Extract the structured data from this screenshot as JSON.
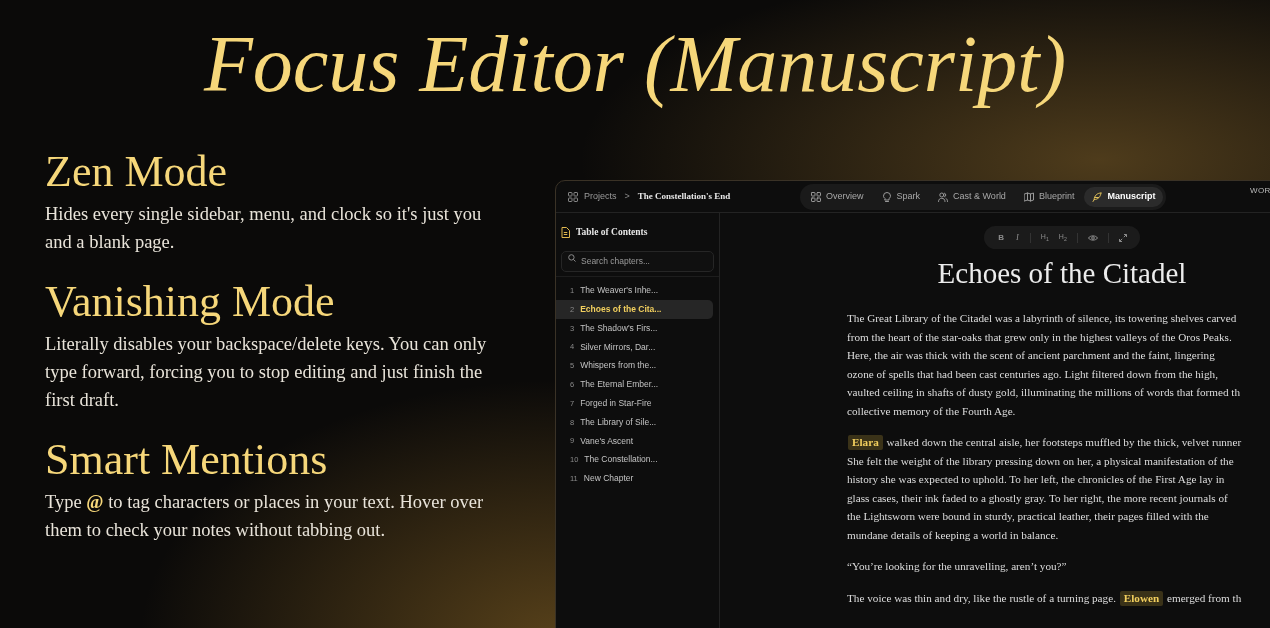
{
  "headline": "Focus Editor (Manuscript)",
  "features": [
    {
      "title": "Zen Mode",
      "description": [
        {
          "text": "Hides every single sidebar, menu, and clock so it's just you and a blank page.",
          "kind": "plain"
        }
      ]
    },
    {
      "title": "Vanishing Mode",
      "description": [
        {
          "text": "Literally disables your backspace/delete keys. You can only type forward, forcing you to stop editing and just finish the first draft.",
          "kind": "plain"
        }
      ]
    },
    {
      "title": "Smart Mentions",
      "description": [
        {
          "text": "Type ",
          "kind": "plain"
        },
        {
          "text": "@",
          "kind": "accent"
        },
        {
          "text": " to tag characters or places in your text. Hover over them to check your notes without tabbing out.",
          "kind": "plain"
        }
      ]
    }
  ],
  "app": {
    "breadcrumb": {
      "root": "Projects",
      "separator": ">",
      "current": "The Constellation's End"
    },
    "tabs": [
      {
        "label": "Overview",
        "selected": false
      },
      {
        "label": "Spark",
        "selected": false
      },
      {
        "label": "Cast & World",
        "selected": false
      },
      {
        "label": "Blueprint",
        "selected": false
      },
      {
        "label": "Manuscript",
        "selected": true
      }
    ],
    "top_right_label": "WOR",
    "sidebar": {
      "title": "Table of Contents",
      "search": {
        "placeholder": "Search chapters..."
      },
      "chapters": [
        {
          "number": "1",
          "title": "The Weaver's Inhe...",
          "selected": false
        },
        {
          "number": "2",
          "title": "Echoes of the Cita...",
          "selected": true
        },
        {
          "number": "3",
          "title": "The Shadow's Firs...",
          "selected": false
        },
        {
          "number": "4",
          "title": "Silver Mirrors, Dar...",
          "selected": false
        },
        {
          "number": "5",
          "title": "Whispers from the...",
          "selected": false
        },
        {
          "number": "6",
          "title": "The Eternal Ember...",
          "selected": false
        },
        {
          "number": "7",
          "title": "Forged in Star-Fire",
          "selected": false
        },
        {
          "number": "8",
          "title": "The Library of Sile...",
          "selected": false
        },
        {
          "number": "9",
          "title": "Vane's Ascent",
          "selected": false
        },
        {
          "number": "10",
          "title": "The Constellation...",
          "selected": false
        },
        {
          "number": "11",
          "title": "New Chapter",
          "selected": false
        }
      ]
    },
    "toolbar": {
      "buttons": [
        {
          "label": "B",
          "kind": "bold"
        },
        {
          "label": "I",
          "kind": "italic"
        },
        {
          "label": "H$_{1}$",
          "kind": "heading"
        },
        {
          "label": "H$_{2}$",
          "kind": "heading"
        },
        {
          "kind": "eye"
        },
        {
          "kind": "expand"
        }
      ]
    },
    "chapter_title": "Echoes of the Citadel",
    "paragraphs": [
      {
        "lines": [
          [
            {
              "text": "The Great Library of the Citadel was a labyrinth of silence, its towering shelves carved",
              "kind": "plain"
            }
          ],
          [
            {
              "text": "from the heart of the star-oaks that grew only in the highest valleys of the Oros Peaks.",
              "kind": "plain"
            }
          ],
          [
            {
              "text": "Here, the air was thick with the scent of ancient parchment and the faint, lingering",
              "kind": "plain"
            }
          ],
          [
            {
              "text": "ozone of spells that had been cast centuries ago. Light filtered down from the high,",
              "kind": "plain"
            }
          ],
          [
            {
              "text": "vaulted ceiling in shafts of dusty gold, illuminating the millions of words that formed th",
              "kind": "plain"
            }
          ],
          [
            {
              "text": "collective memory of the Fourth Age.",
              "kind": "plain"
            }
          ]
        ]
      },
      {
        "lines": [
          [
            {
              "text": "Elara",
              "kind": "mention"
            },
            {
              "text": " walked down the central aisle, her footsteps muffled by the thick, velvet runner",
              "kind": "plain"
            }
          ],
          [
            {
              "text": "She felt the weight of the library pressing down on her, a physical manifestation of the",
              "kind": "plain"
            }
          ],
          [
            {
              "text": "history she was expected to uphold. To her left, the chronicles of the First Age lay in",
              "kind": "plain"
            }
          ],
          [
            {
              "text": "glass cases, their ink faded to a ghostly gray. To her right, the more recent journals of",
              "kind": "plain"
            }
          ],
          [
            {
              "text": "the Lightsworn were bound in sturdy, practical leather, their pages filled with the",
              "kind": "plain"
            }
          ],
          [
            {
              "text": "mundane details of keeping a world in balance.",
              "kind": "plain"
            }
          ]
        ]
      },
      {
        "lines": [
          [
            {
              "text": "“You’re looking for the unravelling, aren’t you?”",
              "kind": "plain"
            }
          ]
        ]
      },
      {
        "lines": [
          [
            {
              "text": "The voice was thin and dry, like the rustle of a turning page. ",
              "kind": "plain"
            },
            {
              "text": "Elowen",
              "kind": "mention"
            },
            {
              "text": " emerged from th",
              "kind": "plain"
            }
          ]
        ]
      }
    ]
  }
}
